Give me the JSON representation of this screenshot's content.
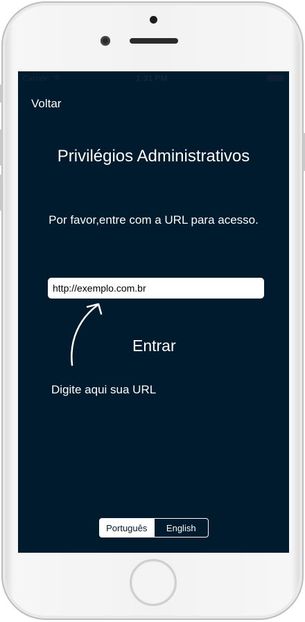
{
  "statusbar": {
    "carrier": "Carrier",
    "wifi_icon": "wifi-icon",
    "time": "1:31 PM"
  },
  "nav": {
    "back_label": "Voltar"
  },
  "main": {
    "title": "Privilégios Administrativos",
    "subtitle": "Por favor,entre com a URL para acesso.",
    "url_value": "http://exemplo.com.br",
    "submit_label": "Entrar",
    "hint": "Digite aqui sua URL"
  },
  "language": {
    "options": [
      "Português",
      "English"
    ],
    "selected": "Português"
  },
  "colors": {
    "background": "#001a2e",
    "text": "#ffffff"
  }
}
